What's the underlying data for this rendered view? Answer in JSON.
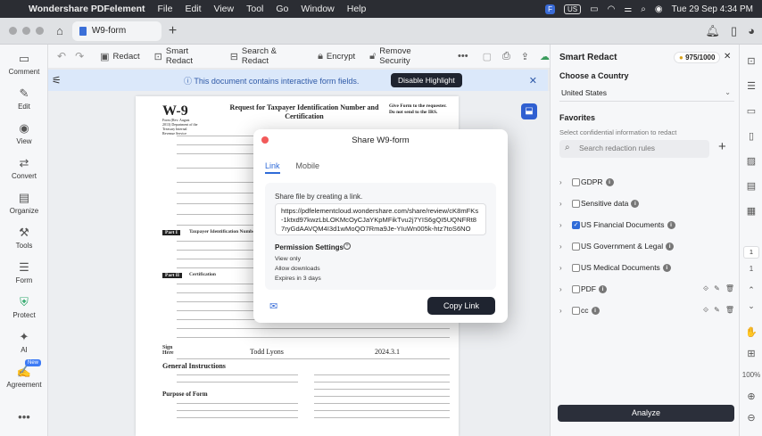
{
  "menubar": {
    "app": "Wondershare PDFelement",
    "items": [
      "File",
      "Edit",
      "View",
      "Tool",
      "Go",
      "Window",
      "Help"
    ],
    "us_badge": "US",
    "datetime": "Tue 29 Sep 4:34 PM"
  },
  "tabbar": {
    "tab_label": "W9-form"
  },
  "leftbar": {
    "items": [
      {
        "label": "Comment",
        "icon": "comment-icon"
      },
      {
        "label": "Edit",
        "icon": "edit-icon"
      },
      {
        "label": "View",
        "icon": "eye-icon"
      },
      {
        "label": "Convert",
        "icon": "convert-icon"
      },
      {
        "label": "Organize",
        "icon": "organize-icon"
      },
      {
        "label": "Tools",
        "icon": "tools-icon"
      },
      {
        "label": "Form",
        "icon": "form-icon"
      },
      {
        "label": "Protect",
        "icon": "shield-icon"
      },
      {
        "label": "AI",
        "icon": "ai-icon"
      },
      {
        "label": "Agreement",
        "icon": "agreement-icon"
      }
    ],
    "new_badge": "New"
  },
  "toolbar": {
    "redact": "Redact",
    "smart_redact": "Smart Redact",
    "search_redact": "Search & Redact",
    "encrypt": "Encrypt",
    "remove_security": "Remove Security"
  },
  "infobar": {
    "message": "This document contains interactive form fields.",
    "button": "Disable Highlight"
  },
  "document": {
    "form_no": "W-9",
    "form_sub": "Form (Rev. August 2013) Department of the Treasury Internal Revenue Service",
    "title": "Request for Taxpayer Identification Number and Certification",
    "give_form": "Give Form to the requester. Do not send to the IRS.",
    "part1": "Part I",
    "part1_title": "Taxpayer Identification Number (TIN)",
    "part2": "Part II",
    "part2_title": "Certification",
    "sign_label": "Sign Here",
    "signature_name": "Todd Lyons",
    "date_value": "2024.3.1",
    "general_instructions": "General Instructions",
    "purpose_of_form": "Purpose of Form"
  },
  "modal": {
    "title": "Share W9-form",
    "tab_link": "Link",
    "tab_mobile": "Mobile",
    "share_text": "Share file by creating a link.",
    "url": "https://pdfelementcloud.wondershare.com/share/review/cK8mFKs-1ktxd97kwzLbLOKMcOyCJaYKpMFikTvu2j7YIS6gQI5UQNFRt87ryGdAAVQM4I3d1wMoQO7Rma9Je-YIuWn005k-htz7toS6NO",
    "permission_settings": "Permission Settings",
    "options": [
      "View only",
      "Allow downloads",
      "Expires in 3 days"
    ],
    "copy_button": "Copy Link"
  },
  "rpanel": {
    "title": "Smart Redact",
    "credits": "975/1000",
    "choose_country": "Choose a Country",
    "country": "United States",
    "favorites": "Favorites",
    "note": "Select confidential information to redact",
    "search_placeholder": "Search redaction rules",
    "rules": [
      {
        "label": "GDPR",
        "checked": false,
        "actions": false
      },
      {
        "label": "Sensitive data",
        "checked": false,
        "actions": false
      },
      {
        "label": "US Financial Documents",
        "checked": true,
        "actions": false
      },
      {
        "label": "US Government & Legal",
        "checked": false,
        "actions": false
      },
      {
        "label": "US Medical Documents",
        "checked": false,
        "actions": false
      },
      {
        "label": "PDF",
        "checked": false,
        "actions": true
      },
      {
        "label": "cc",
        "checked": false,
        "actions": true
      }
    ],
    "analyze": "Analyze"
  },
  "rtools": {
    "page_current": "1",
    "page_total": "1",
    "zoom": "100%"
  }
}
